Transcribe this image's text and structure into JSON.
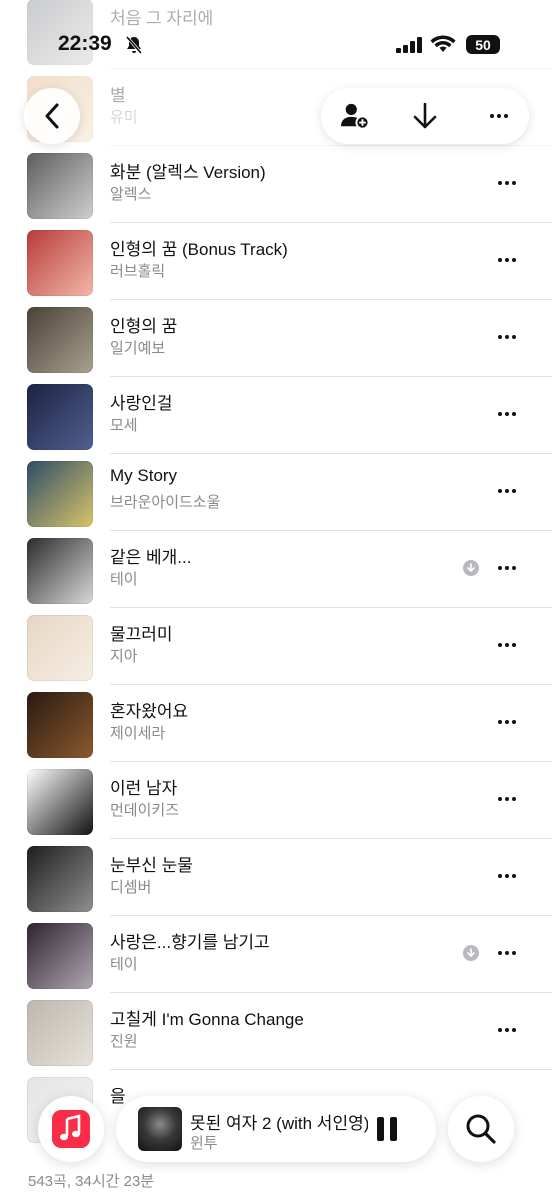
{
  "status_bar": {
    "time": "22:39",
    "battery": "50"
  },
  "songs": [
    {
      "title": "처음 그 자리에",
      "artist": "",
      "art_colors": [
        "#6a6f78",
        "#c9c4bf"
      ],
      "downloaded": false
    },
    {
      "title": "별",
      "artist": "유미",
      "art_colors": [
        "#d9a36b",
        "#f1d7b1"
      ],
      "downloaded": false
    },
    {
      "title": "화분 (알렉스 Version)",
      "artist": "알렉스",
      "art_colors": [
        "#5d5d5d",
        "#cfcfcf"
      ],
      "downloaded": false
    },
    {
      "title": "인형의 꿈 (Bonus Track)",
      "artist": "러브홀릭",
      "art_colors": [
        "#b83b3b",
        "#f3b7a9"
      ],
      "downloaded": false
    },
    {
      "title": "인형의 꿈",
      "artist": "일기예보",
      "art_colors": [
        "#4a4237",
        "#a8a08f"
      ],
      "downloaded": false
    },
    {
      "title": "사랑인걸",
      "artist": "모세",
      "art_colors": [
        "#1c2342",
        "#51608f"
      ],
      "downloaded": false
    },
    {
      "title": "My Story",
      "artist": "브라운아이드소울",
      "art_colors": [
        "#2f4d68",
        "#d7c469"
      ],
      "downloaded": false
    },
    {
      "title": "같은 베개...",
      "artist": "테이",
      "art_colors": [
        "#2b2b2b",
        "#d8d8d8"
      ],
      "downloaded": true
    },
    {
      "title": "물끄러미",
      "artist": "지아",
      "art_colors": [
        "#e6d7c3",
        "#f6eee4"
      ],
      "downloaded": false
    },
    {
      "title": "혼자왔어요",
      "artist": "제이세라",
      "art_colors": [
        "#2a1a14",
        "#8a5a2c"
      ],
      "downloaded": false
    },
    {
      "title": "이런 남자",
      "artist": "먼데이키즈",
      "art_colors": [
        "#ffffff",
        "#111111"
      ],
      "downloaded": false
    },
    {
      "title": "눈부신 눈물",
      "artist": "디셈버",
      "art_colors": [
        "#1d1d1d",
        "#8f8f8f"
      ],
      "downloaded": false
    },
    {
      "title": "사랑은...향기를 남기고",
      "artist": "테이",
      "art_colors": [
        "#2e2430",
        "#b0a8b3"
      ],
      "downloaded": true
    },
    {
      "title": "고칠게 I'm Gonna Change",
      "artist": "진원",
      "art_colors": [
        "#bdb7ae",
        "#e7e2da"
      ],
      "downloaded": false
    },
    {
      "title": "을",
      "artist": "",
      "art_colors": [
        "#e5e5e5",
        "#f2f2f2"
      ],
      "downloaded": false
    }
  ],
  "footer": {
    "count": "543곡, 34시간 23분"
  },
  "now_playing": {
    "title": "못된 여자 2 (with 서인영)",
    "artist": "윈투"
  },
  "icons": {
    "back": "chevron-left-icon",
    "add_user": "person-add-icon",
    "download": "arrow-down-icon",
    "more": "ellipsis-icon",
    "music": "music-app-icon",
    "pause": "pause-icon",
    "search": "magnifier-icon"
  },
  "colors": {
    "accent": "#fa2d48",
    "secondary_text": "#8a8a8e"
  }
}
